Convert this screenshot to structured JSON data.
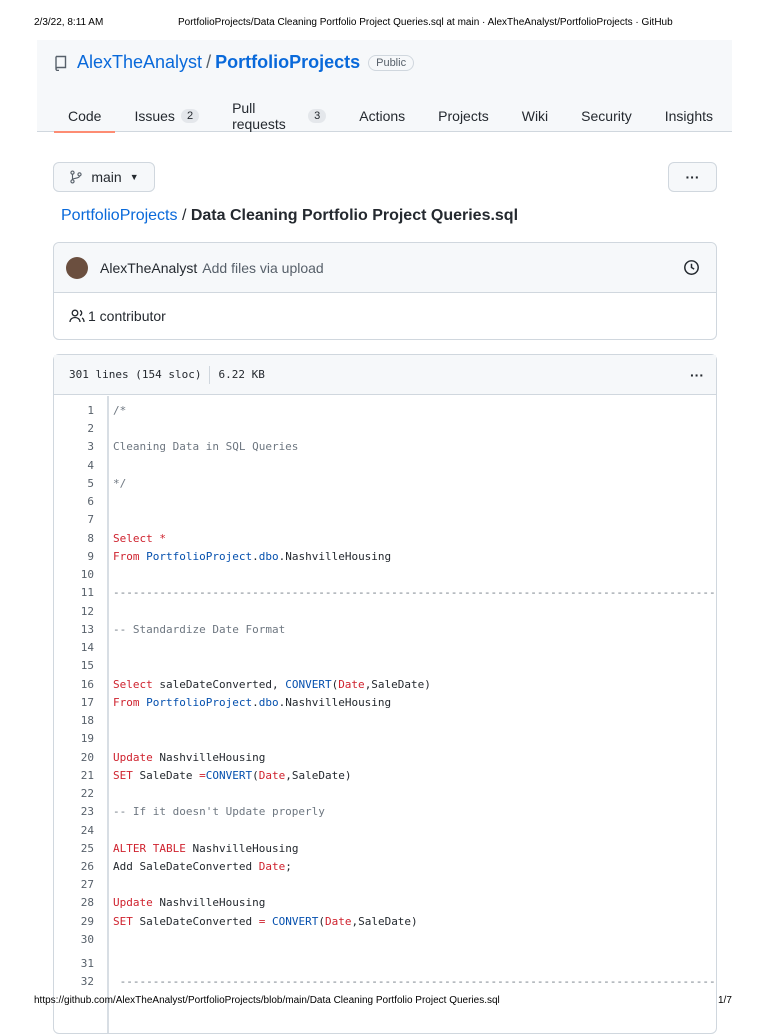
{
  "print": {
    "date": "2/3/22, 8:11 AM",
    "title": "PortfolioProjects/Data Cleaning Portfolio Project Queries.sql at main · AlexTheAnalyst/PortfolioProjects · GitHub",
    "url": "https://github.com/AlexTheAnalyst/PortfolioProjects/blob/main/Data Cleaning Portfolio Project Queries.sql",
    "page": "1/7"
  },
  "repo": {
    "owner": "AlexTheAnalyst",
    "sep": "/",
    "name": "PortfolioProjects",
    "visibility": "Public"
  },
  "tabs": [
    {
      "label": "Code"
    },
    {
      "label": "Issues",
      "count": "2"
    },
    {
      "label": "Pull requests",
      "count": "3"
    },
    {
      "label": "Actions"
    },
    {
      "label": "Projects"
    },
    {
      "label": "Wiki"
    },
    {
      "label": "Security"
    },
    {
      "label": "Insights"
    }
  ],
  "branch": "main",
  "more": "···",
  "breadcrumb": {
    "repo": "PortfolioProjects",
    "sep": " / ",
    "file": "Data Cleaning Portfolio Project Queries.sql"
  },
  "commit": {
    "author": "AlexTheAnalyst",
    "message": "Add files via upload",
    "contributors": "1 contributor"
  },
  "file": {
    "lines": "301 lines (154 sloc)",
    "size": "6.22 KB"
  },
  "code": [
    [
      [
        "cm",
        "/*"
      ]
    ],
    [],
    [
      [
        "cm",
        "Cleaning Data in SQL Queries"
      ]
    ],
    [],
    [
      [
        "cm",
        "*/"
      ]
    ],
    [],
    [],
    [
      [
        "kw",
        "Select *"
      ]
    ],
    [
      [
        "kw",
        "From "
      ],
      [
        "en",
        "PortfolioProject"
      ],
      [
        "",
        "."
      ],
      [
        "en",
        "dbo"
      ],
      [
        "",
        ".NashvilleHousing"
      ]
    ],
    [],
    [
      [
        "cm",
        "--------------------------------------------------------------------------------------------------------"
      ]
    ],
    [],
    [
      [
        "cm",
        "-- Standardize Date Format"
      ]
    ],
    [],
    [],
    [
      [
        "kw",
        "Select"
      ],
      [
        "",
        " saleDateConverted, "
      ],
      [
        "en",
        "CONVERT"
      ],
      [
        "",
        "("
      ],
      [
        "kw",
        "Date"
      ],
      [
        "",
        ",SaleDate)"
      ]
    ],
    [
      [
        "kw",
        "From "
      ],
      [
        "en",
        "PortfolioProject"
      ],
      [
        "",
        "."
      ],
      [
        "en",
        "dbo"
      ],
      [
        "",
        ".NashvilleHousing"
      ]
    ],
    [],
    [],
    [
      [
        "kw",
        "Update"
      ],
      [
        "",
        " NashvilleHousing"
      ]
    ],
    [
      [
        "kw",
        "SET"
      ],
      [
        "",
        " SaleDate "
      ],
      [
        "kw",
        "="
      ],
      [
        " ",
        ""
      ],
      [
        "en",
        "CONVERT"
      ],
      [
        "",
        "("
      ],
      [
        "kw",
        "Date"
      ],
      [
        "",
        ",SaleDate)"
      ]
    ],
    [],
    [
      [
        "cm",
        "-- If it doesn't Update properly"
      ]
    ],
    [],
    [
      [
        "kw",
        "ALTER TABLE"
      ],
      [
        "",
        " NashvilleHousing"
      ]
    ],
    [
      [
        "",
        "Add SaleDateConverted "
      ],
      [
        "kw",
        "Date"
      ],
      [
        "",
        ";"
      ]
    ],
    [],
    [
      [
        "kw",
        "Update"
      ],
      [
        "",
        " NashvilleHousing"
      ]
    ],
    [
      [
        "kw",
        "SET"
      ],
      [
        "",
        " SaleDateConverted "
      ],
      [
        "kw",
        "="
      ],
      [
        "",
        " "
      ],
      [
        "en",
        "CONVERT"
      ],
      [
        "",
        "("
      ],
      [
        "kw",
        "Date"
      ],
      [
        "",
        ",SaleDate)"
      ]
    ],
    [],
    [],
    [
      [
        "cm",
        " --------------------------------------------------------------------------------------------------------"
      ]
    ]
  ]
}
